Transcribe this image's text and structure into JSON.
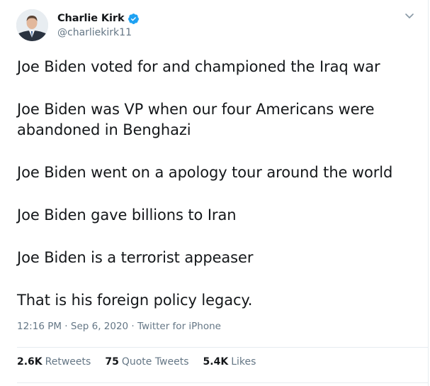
{
  "author": {
    "display_name": "Charlie Kirk",
    "handle": "@charliekirk11",
    "verified": true
  },
  "tweet": {
    "lines": [
      "Joe Biden voted for and championed the Iraq war",
      "Joe Biden was VP when our four Americans were abandoned in Benghazi",
      "Joe Biden went on a apology tour around the world",
      "Joe Biden gave billions to Iran",
      "Joe Biden is a terrorist appeaser",
      "That is his foreign policy legacy."
    ],
    "time": "12:16 PM",
    "date": "Sep 6, 2020",
    "source": "Twitter for iPhone",
    "separator": " · "
  },
  "stats": {
    "retweets_count": "2.6K",
    "retweets_label": "Retweets",
    "quotes_count": "75",
    "quotes_label": "Quote Tweets",
    "likes_count": "5.4K",
    "likes_label": "Likes"
  },
  "icons": {
    "verified": "verified-badge-icon",
    "caret": "chevron-down-icon"
  },
  "colors": {
    "verified_blue": "#1da1f2",
    "secondary_text": "#657786",
    "divider": "#e6ecf0"
  }
}
